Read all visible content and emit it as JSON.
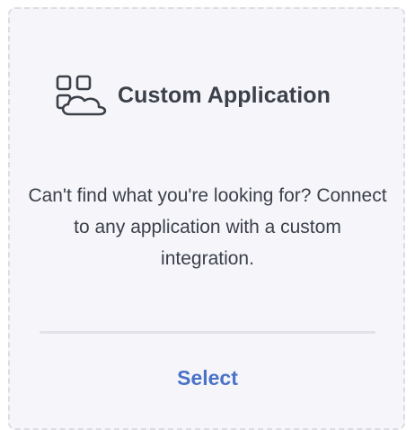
{
  "card": {
    "title": "Custom Application",
    "icon": "apps-cloud-icon",
    "description": "Can't find what you're looking for? Connect to any application with a custom integration.",
    "select_label": "Select"
  },
  "colors": {
    "text": "#3b4049",
    "accent": "#4a72c8",
    "card_background": "#f6f6fa",
    "border": "#dcdce3"
  }
}
